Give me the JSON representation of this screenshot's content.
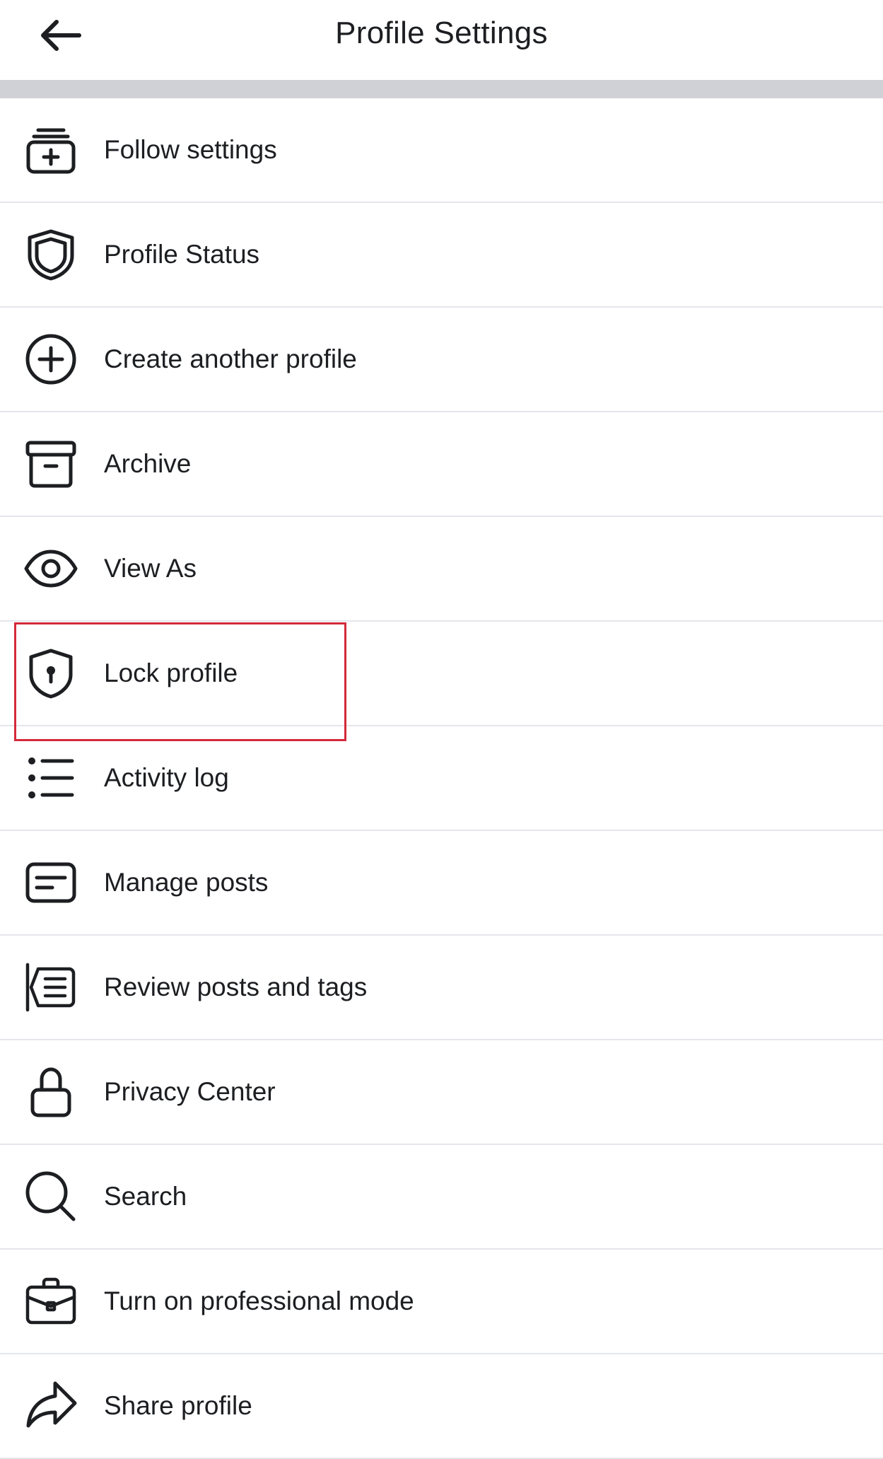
{
  "header": {
    "title": "Profile Settings",
    "back_icon": "arrow-left-icon"
  },
  "items": [
    {
      "label": "Follow settings",
      "icon": "follow-box-plus-icon"
    },
    {
      "label": "Profile Status",
      "icon": "shield-icon"
    },
    {
      "label": "Create another profile",
      "icon": "plus-circle-icon"
    },
    {
      "label": "Archive",
      "icon": "archive-icon"
    },
    {
      "label": "View As",
      "icon": "eye-icon"
    },
    {
      "label": "Lock profile",
      "icon": "shield-keyhole-icon"
    },
    {
      "label": "Activity log",
      "icon": "list-icon"
    },
    {
      "label": "Manage posts",
      "icon": "posts-icon"
    },
    {
      "label": "Review posts and tags",
      "icon": "review-tags-icon"
    },
    {
      "label": "Privacy Center",
      "icon": "lock-icon"
    },
    {
      "label": "Search",
      "icon": "search-icon"
    },
    {
      "label": "Turn on professional mode",
      "icon": "briefcase-icon"
    },
    {
      "label": "Share profile",
      "icon": "share-icon"
    }
  ],
  "colors": {
    "highlight": "#d42a3a",
    "divider_bar": "#cfd1d6",
    "row_border": "#e4e6eb",
    "text": "#1c1e21"
  }
}
